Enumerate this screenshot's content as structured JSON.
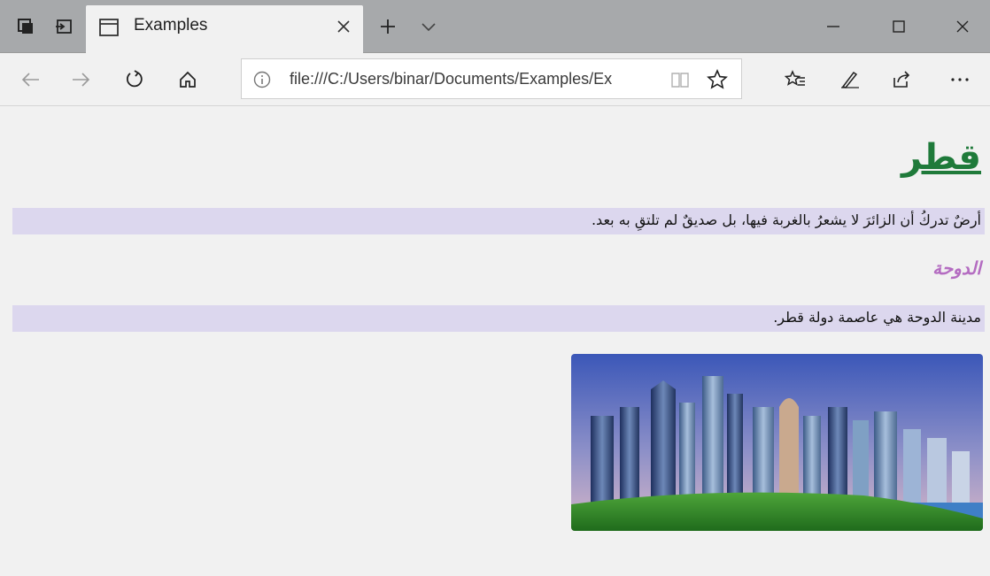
{
  "browser": {
    "tab": {
      "title": "Examples"
    },
    "address": {
      "url": "file:///C:/Users/binar/Documents/Examples/Ex"
    }
  },
  "page": {
    "heading": "قطر",
    "paragraph1": "أرضٌ تدركُ أن الزائرَ لا يشعرُ بالغربة فيها، بل صديقٌ لم تلتقِ به بعد.",
    "subheading": "الدوحة",
    "paragraph2": "مدينة الدوحة هي عاصمة دولة قطر."
  },
  "colors": {
    "heading": "#1f7a3a",
    "subheading": "#b46cc1",
    "highlight_band": "#dcd7ee",
    "titlebar": "#a7a9ab"
  },
  "icons": {
    "titlebar": [
      "tab-preview-icon",
      "set-aside-tabs-icon",
      "page-icon",
      "close-icon",
      "plus-icon",
      "chevron-down-icon"
    ],
    "window": [
      "minimize-icon",
      "maximize-icon",
      "close-icon"
    ],
    "nav": [
      "back-arrow-icon",
      "forward-arrow-icon",
      "refresh-icon",
      "home-icon",
      "info-icon",
      "reading-view-icon",
      "star-icon",
      "favorites-icon",
      "pen-icon",
      "share-icon",
      "more-icon"
    ]
  }
}
